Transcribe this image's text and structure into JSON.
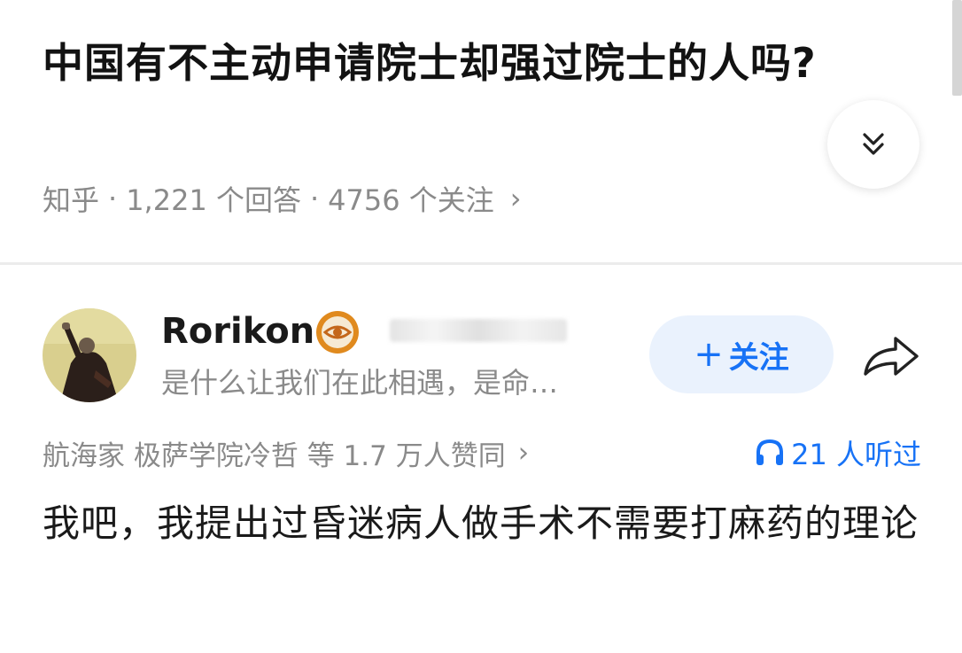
{
  "question": {
    "title": "中国有不主动申请院士却强过院士的人吗?",
    "source": "知乎",
    "answers_count": "1,221 个回答",
    "followers_count": "4756 个关注",
    "meta_separator": "·",
    "meta_chevron": "›"
  },
  "answer": {
    "author": {
      "name": "Rorikon",
      "bio": "是什么让我们在此相遇，是命…"
    },
    "follow_button_plus": "+",
    "follow_button_label": "关注",
    "upvoters": "航海家 极萨学院冷哲 等 1.7 万人赞同",
    "upvoters_chevron": "›",
    "listened": "21 人听过",
    "content": "我吧，我提出过昏迷病人做手术不需要打麻药的理论"
  },
  "colors": {
    "accent": "#1772f6",
    "follow_bg": "#eaf2fd",
    "muted_text": "#8a8a8a",
    "badge": "#e08a1e"
  },
  "icons": {
    "expand": "double-chevron-down-icon",
    "badge": "eye-badge-icon",
    "share": "share-arrow-icon",
    "listen": "headphones-icon"
  }
}
